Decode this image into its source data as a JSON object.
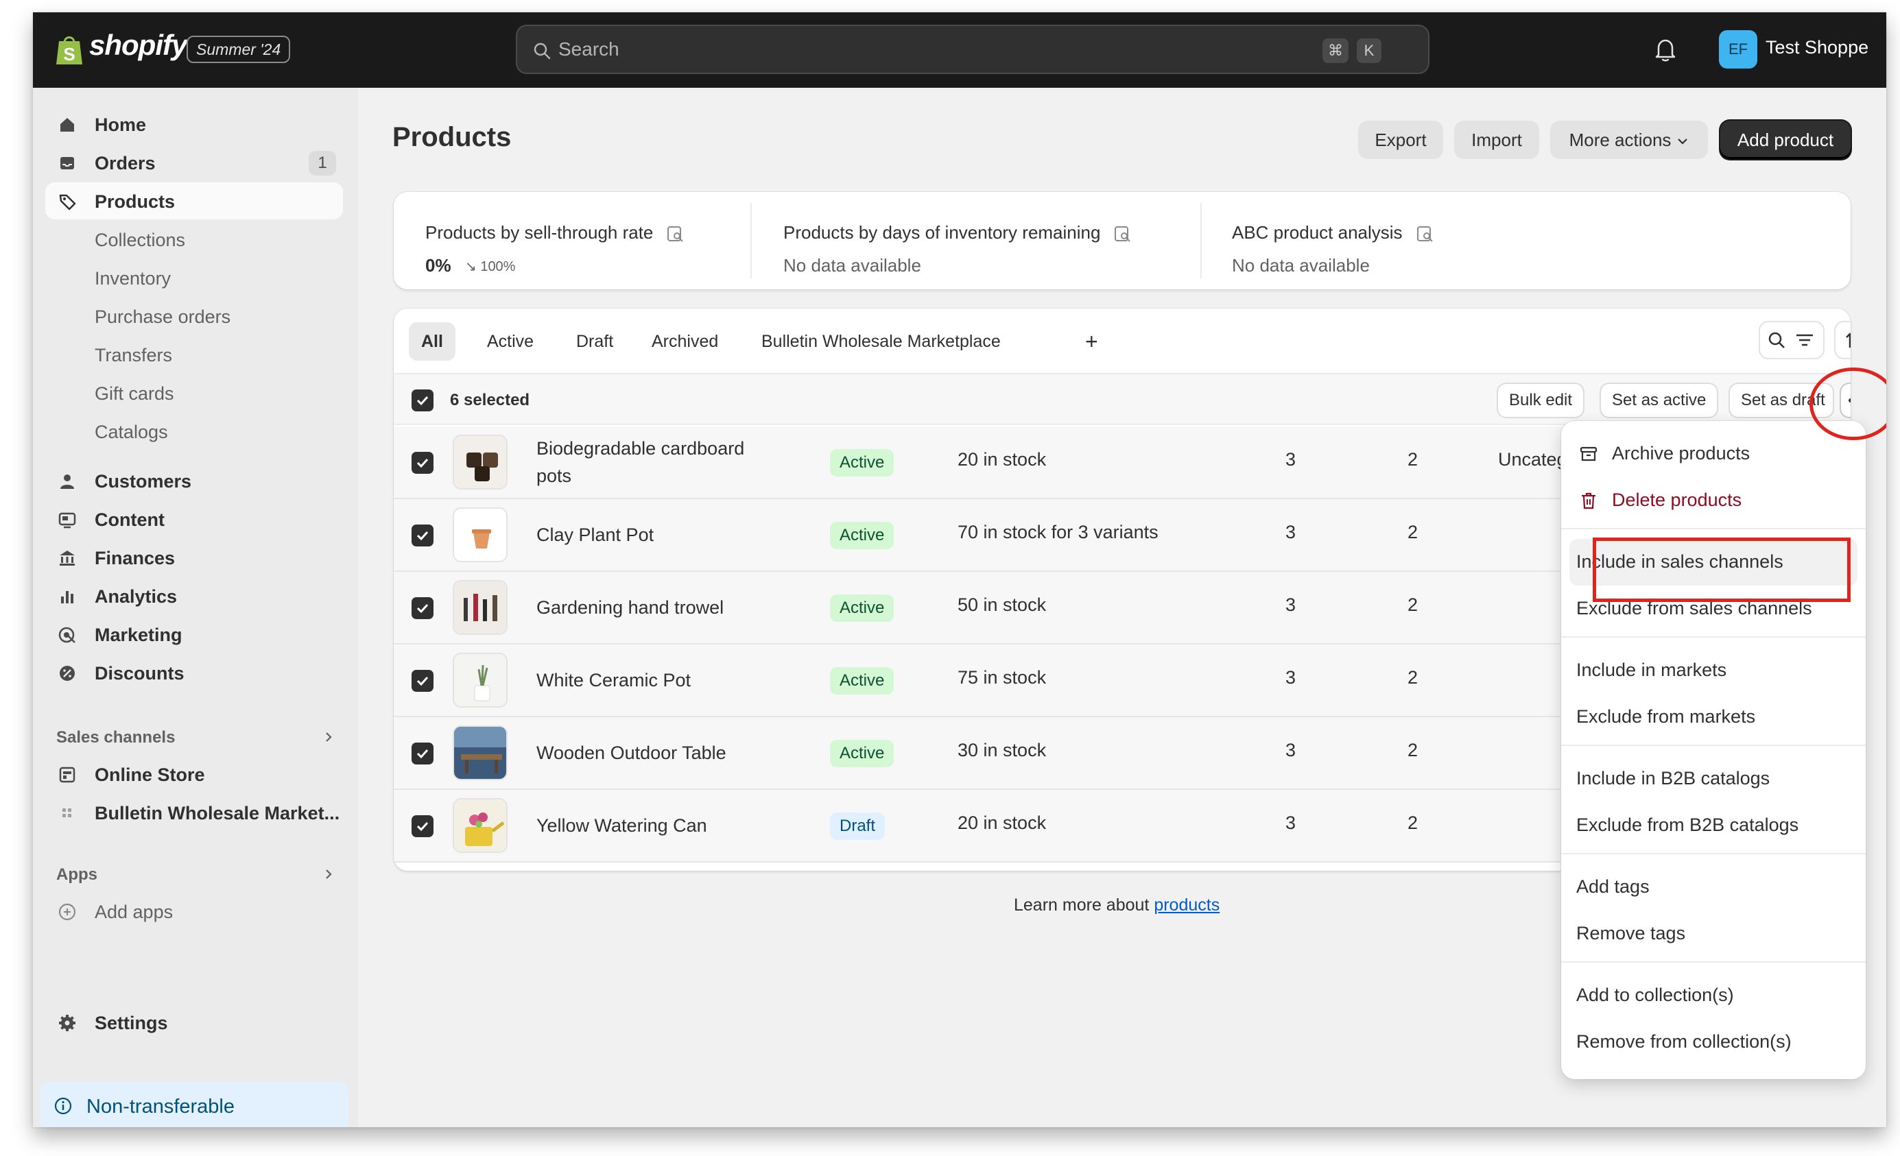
{
  "topbar": {
    "brand": "shopify",
    "edition": "Summer '24",
    "search_placeholder": "Search",
    "shortcut_keys": [
      "⌘",
      "K"
    ],
    "avatar_initials": "EF",
    "store_name": "Test Shoppe"
  },
  "sidebar": {
    "main_items": [
      {
        "label": "Home",
        "icon": "home-icon"
      },
      {
        "label": "Orders",
        "icon": "inbox-icon",
        "count": "1"
      },
      {
        "label": "Products",
        "icon": "tag-icon",
        "active": true
      }
    ],
    "product_subitems": [
      "Collections",
      "Inventory",
      "Purchase orders",
      "Transfers",
      "Gift cards",
      "Catalogs"
    ],
    "other_items": [
      {
        "label": "Customers",
        "icon": "person-icon"
      },
      {
        "label": "Content",
        "icon": "content-icon"
      },
      {
        "label": "Finances",
        "icon": "bank-icon"
      },
      {
        "label": "Analytics",
        "icon": "bar-chart-icon"
      },
      {
        "label": "Marketing",
        "icon": "target-icon"
      },
      {
        "label": "Discounts",
        "icon": "discount-icon"
      }
    ],
    "sales_channels_heading": "Sales channels",
    "sales_channels": [
      {
        "label": "Online Store",
        "icon": "store-icon"
      },
      {
        "label": "Bulletin Wholesale Market...",
        "icon": "app-grid-icon"
      }
    ],
    "apps_heading": "Apps",
    "add_apps": "Add apps",
    "settings": "Settings",
    "notice": "Non-transferable"
  },
  "page": {
    "title": "Products",
    "export": "Export",
    "import": "Import",
    "more_actions": "More actions",
    "add_product": "Add product"
  },
  "analytics": [
    {
      "title": "Products by sell-through rate",
      "value": "0%",
      "delta": "↘ 100%"
    },
    {
      "title": "Products by days of inventory remaining",
      "sub": "No data available"
    },
    {
      "title": "ABC product analysis",
      "sub": "No data available"
    }
  ],
  "tabs": [
    "All",
    "Active",
    "Draft",
    "Archived",
    "Bulletin Wholesale Marketplace",
    "+"
  ],
  "bulk": {
    "selected": "6 selected",
    "bulk_edit": "Bulk edit",
    "set_active": "Set as active",
    "set_draft": "Set as draft"
  },
  "products": [
    {
      "name_line1": "Biodegradable cardboard",
      "name_line2": "pots",
      "status": "Active",
      "inventory": "20 in stock",
      "col_a": "3",
      "col_b": "2",
      "category": "Uncategorized"
    },
    {
      "name_line1": "Clay Plant Pot",
      "status": "Active",
      "inventory": "70 in stock for 3 variants",
      "col_a": "3",
      "col_b": "2"
    },
    {
      "name_line1": "Gardening hand trowel",
      "status": "Active",
      "inventory": "50 in stock",
      "col_a": "3",
      "col_b": "2"
    },
    {
      "name_line1": "White Ceramic Pot",
      "status": "Active",
      "inventory": "75 in stock",
      "col_a": "3",
      "col_b": "2"
    },
    {
      "name_line1": "Wooden Outdoor Table",
      "status": "Active",
      "inventory": "30 in stock",
      "col_a": "3",
      "col_b": "2"
    },
    {
      "name_line1": "Yellow Watering Can",
      "status": "Draft",
      "inventory": "20 in stock",
      "col_a": "3",
      "col_b": "2"
    }
  ],
  "footer": {
    "learn_text": "Learn more about",
    "learn_link": "products"
  },
  "menu": [
    {
      "label": "Archive products",
      "icon": "archive-icon"
    },
    {
      "label": "Delete products",
      "icon": "trash-icon",
      "danger": true
    },
    {
      "label": "Include in sales channels",
      "highlighted": true
    },
    {
      "label": "Exclude from sales channels"
    },
    {
      "label": "Include in markets"
    },
    {
      "label": "Exclude from markets"
    },
    {
      "label": "Include in B2B catalogs"
    },
    {
      "label": "Exclude from B2B catalogs"
    },
    {
      "label": "Add tags"
    },
    {
      "label": "Remove tags"
    },
    {
      "label": "Add to collection(s)"
    },
    {
      "label": "Remove from collection(s)"
    }
  ],
  "colors": {
    "topbar": "#1a1a1a",
    "annotation": "#e0241c",
    "active_badge": "#d4f8d3",
    "draft_badge": "#e0f0ff",
    "link": "#005bd3"
  }
}
